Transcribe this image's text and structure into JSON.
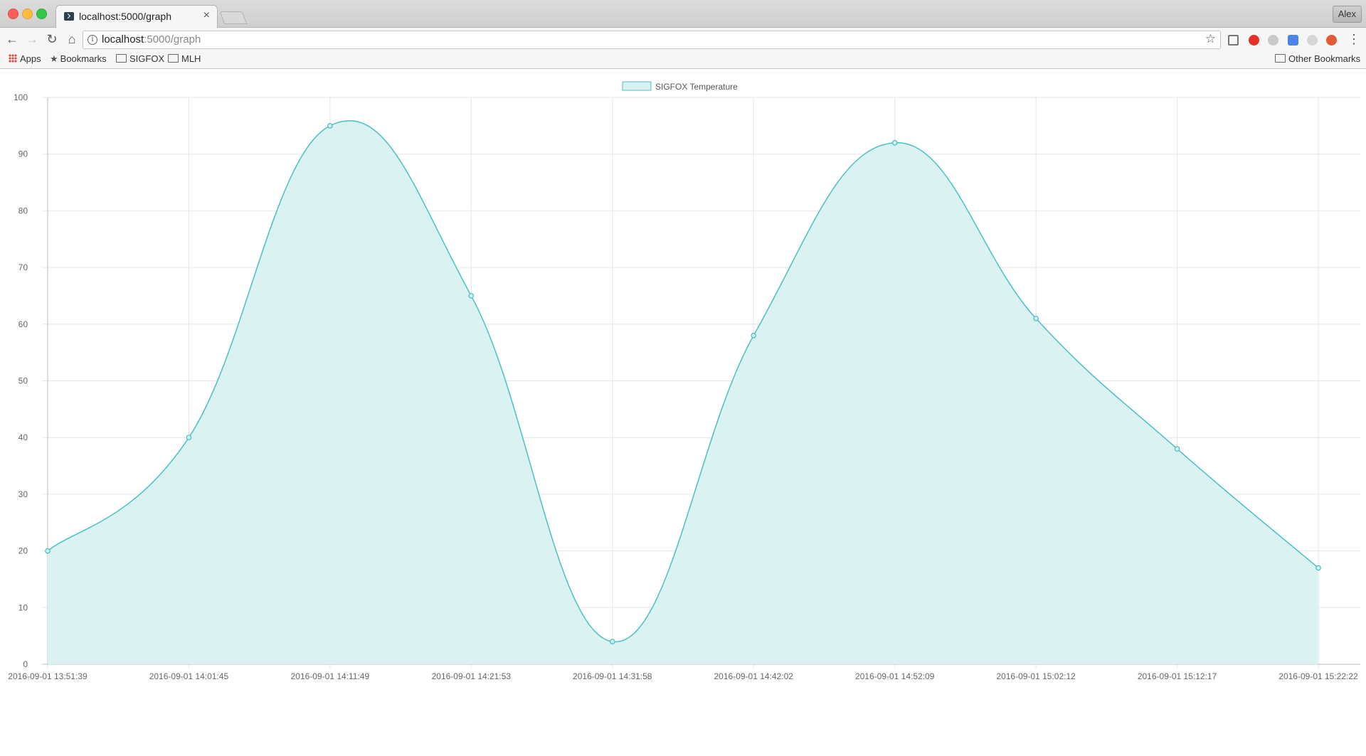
{
  "browser": {
    "tab_title": "localhost:5000/graph",
    "tab_close": "×",
    "url_host": "localhost",
    "url_path": ":5000/graph",
    "profile": "Alex",
    "bookmarks": [
      {
        "label": "Apps",
        "icon": "apps-grid-icon"
      },
      {
        "label": "Bookmarks",
        "icon": "star-icon"
      },
      {
        "label": "SIGFOX",
        "icon": "folder-icon"
      },
      {
        "label": "MLH",
        "icon": "folder-icon"
      }
    ],
    "other_bookmarks": "Other Bookmarks"
  },
  "chart_data": {
    "type": "area",
    "x": [
      "2016-09-01 13:51:39",
      "2016-09-01 14:01:45",
      "2016-09-01 14:11:49",
      "2016-09-01 14:21:53",
      "2016-09-01 14:31:58",
      "2016-09-01 14:42:02",
      "2016-09-01 14:52:09",
      "2016-09-01 15:02:12",
      "2016-09-01 15:12:17",
      "2016-09-01 15:22:22"
    ],
    "series": [
      {
        "name": "SIGFOX Temperature",
        "values": [
          20,
          40,
          95,
          65,
          4,
          58,
          92,
          61,
          38,
          17
        ]
      }
    ],
    "ylim": [
      0,
      100
    ],
    "yticks": [
      0,
      10,
      20,
      30,
      40,
      50,
      60,
      70,
      80,
      90,
      100
    ],
    "grid": true,
    "legend": "top-center",
    "line_color": "#4bc0c0",
    "fill_color": "#d9f1f2",
    "grid_color": "#e6e6e6"
  }
}
